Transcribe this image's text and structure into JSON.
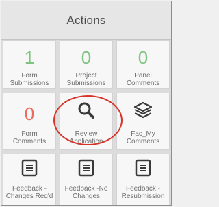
{
  "header": {
    "title": "Actions"
  },
  "tiles": [
    {
      "count": "1",
      "label_line1": "Form",
      "label_line2": "Submissions"
    },
    {
      "count": "0",
      "label_line1": "Project",
      "label_line2": "Submissions"
    },
    {
      "count": "0",
      "label_line1": "Panel",
      "label_line2": "Comments"
    },
    {
      "count": "0",
      "label_line1": "Form",
      "label_line2": "Comments"
    },
    {
      "icon": "search-icon",
      "label_line1": "Review",
      "label_line2": "Application"
    },
    {
      "icon": "layers-icon",
      "label_line1": "Fac_My",
      "label_line2": "Comments"
    },
    {
      "icon": "document-icon",
      "label_line1": "Feedback -",
      "label_line2": "Changes Req'd"
    },
    {
      "icon": "document-icon",
      "label_line1": "Feedback -No",
      "label_line2": "Changes"
    },
    {
      "icon": "document-icon",
      "label_line1": "Feedback -",
      "label_line2": "Resubmission"
    }
  ],
  "colors": {
    "count_green": "#7dc47d",
    "count_red": "#ec6b5e",
    "highlight_circle": "#d6352a"
  }
}
